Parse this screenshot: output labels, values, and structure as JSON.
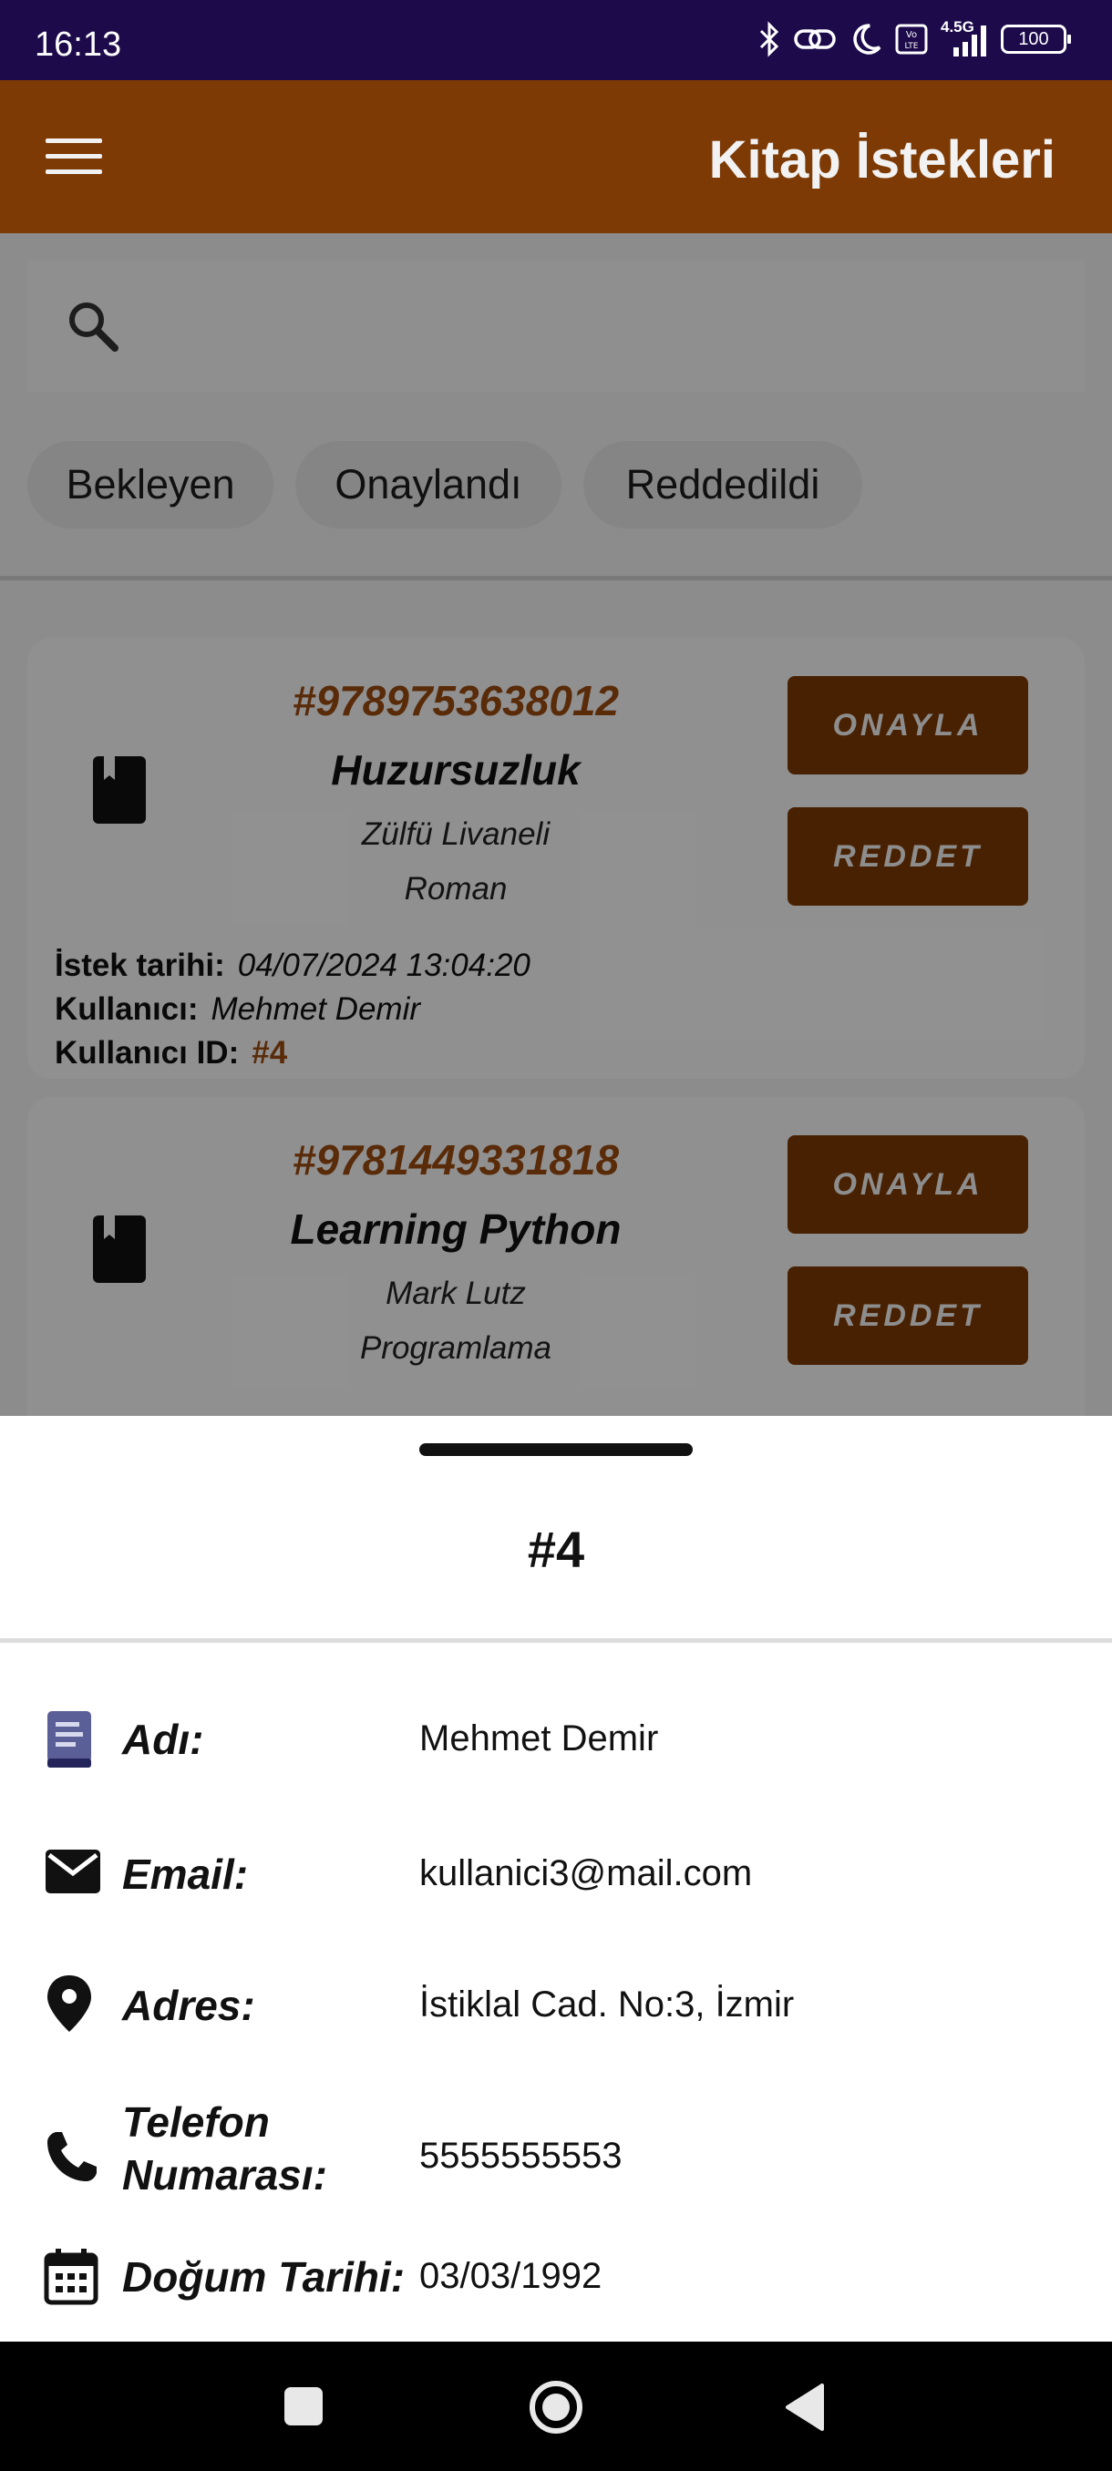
{
  "status_bar": {
    "time": "16:13",
    "network": "4.5G",
    "battery": "100"
  },
  "app_bar": {
    "title": "Kitap İstekleri",
    "menu_icon": "hamburger-menu-icon"
  },
  "search": {
    "icon": "search-icon",
    "value": "",
    "placeholder": ""
  },
  "filters": [
    "Bekleyen",
    "Onaylandı",
    "Reddedildi"
  ],
  "requests": [
    {
      "isbn": "#9789753638012",
      "title": "Huzursuzluk",
      "author": "Zülfü Livaneli",
      "genre": "Roman",
      "approve_label": "ONAYLA",
      "reject_label": "REDDET",
      "date_label": "İstek tarihi:",
      "date": "04/07/2024 13:04:20",
      "user_label": "Kullanıcı:",
      "user": "Mehmet Demir",
      "user_id_label": "Kullanıcı ID:",
      "user_id": "#4"
    },
    {
      "isbn": "#9781449331818",
      "title": "Learning Python",
      "author": "Mark Lutz",
      "genre": "Programlama",
      "approve_label": "ONAYLA",
      "reject_label": "REDDET"
    }
  ],
  "sheet": {
    "title": "#4",
    "fields": [
      {
        "icon": "book-icon",
        "label": "Adı:",
        "value": "Mehmet Demir"
      },
      {
        "icon": "email-icon",
        "label": "Email:",
        "value": "kullanici3@mail.com"
      },
      {
        "icon": "location-pin-icon",
        "label": "Adres:",
        "value": "İstiklal Cad. No:3, İzmir"
      },
      {
        "icon": "phone-icon",
        "label_line1": "Telefon",
        "label_line2": "Numarası:",
        "value": "5555555553"
      },
      {
        "icon": "calendar-icon",
        "label": "Doğum Tarihi:",
        "value": "03/03/1992"
      }
    ]
  },
  "colors": {
    "primary": "#7d3a05",
    "accent_text": "#9a4a10",
    "status_bar": "#1c0a4a"
  }
}
